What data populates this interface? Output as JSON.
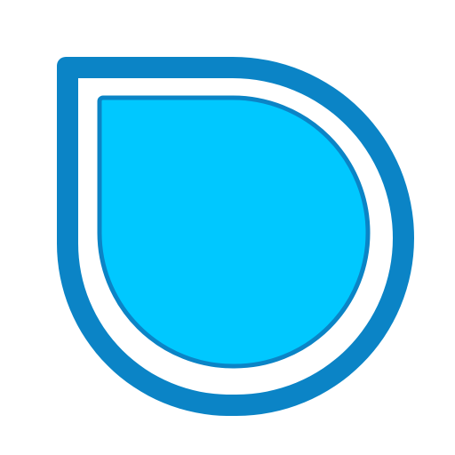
{
  "icon": {
    "name": "water-drop-logo-icon",
    "colors": {
      "background": "#ffffff",
      "outer_stroke": "#0b84c6",
      "gap": "#ffffff",
      "inner_fill": "#00c8ff",
      "inner_stroke": "#0b84c6"
    }
  }
}
